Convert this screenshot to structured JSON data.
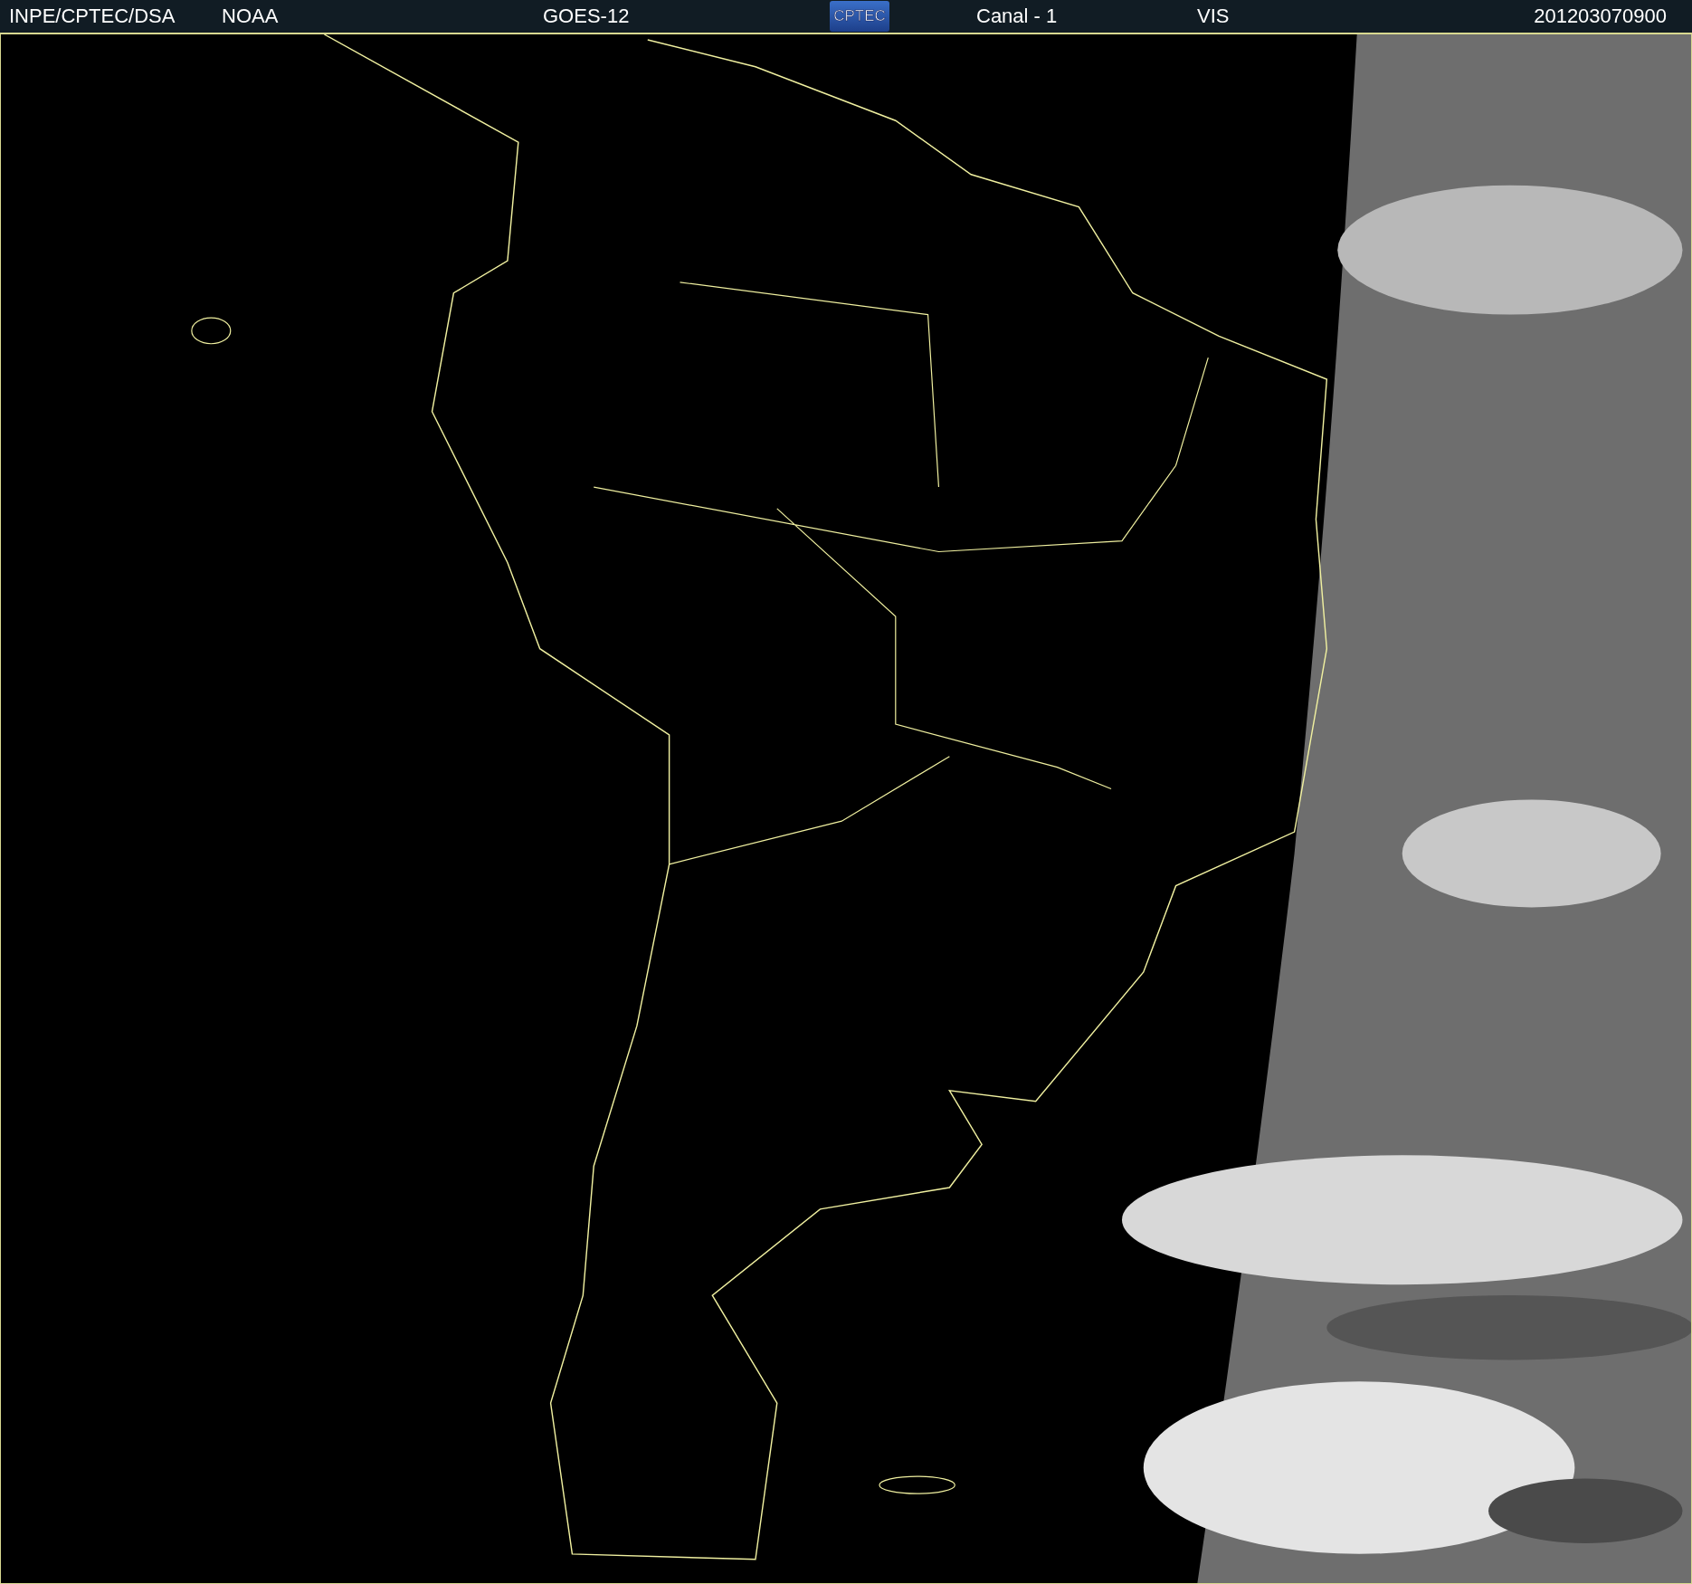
{
  "header": {
    "agency": "INPE/CPTEC/DSA",
    "operator": "NOAA",
    "satellite": "GOES-12",
    "logo_text": "CPTEC",
    "channel": "Canal - 1",
    "band": "VIS",
    "timestamp": "201203070900"
  }
}
